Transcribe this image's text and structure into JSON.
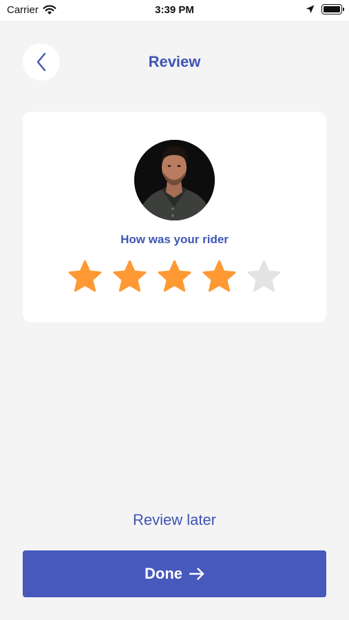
{
  "status_bar": {
    "carrier": "Carrier",
    "time": "3:39 PM",
    "icons": [
      "wifi-icon",
      "location-arrow-icon",
      "battery-icon"
    ]
  },
  "header": {
    "back_icon": "chevron-left-icon",
    "title": "Review"
  },
  "card": {
    "question": "How was your rider",
    "rating": {
      "value": 4,
      "max": 5
    }
  },
  "footer": {
    "review_later_label": "Review later",
    "done_label": "Done",
    "done_icon": "arrow-right-icon"
  },
  "colors": {
    "accent": "#3f55b4",
    "button": "#4759bb",
    "star_filled": "#ff9933",
    "star_empty": "#e3e3e3",
    "background": "#f4f4f4"
  }
}
